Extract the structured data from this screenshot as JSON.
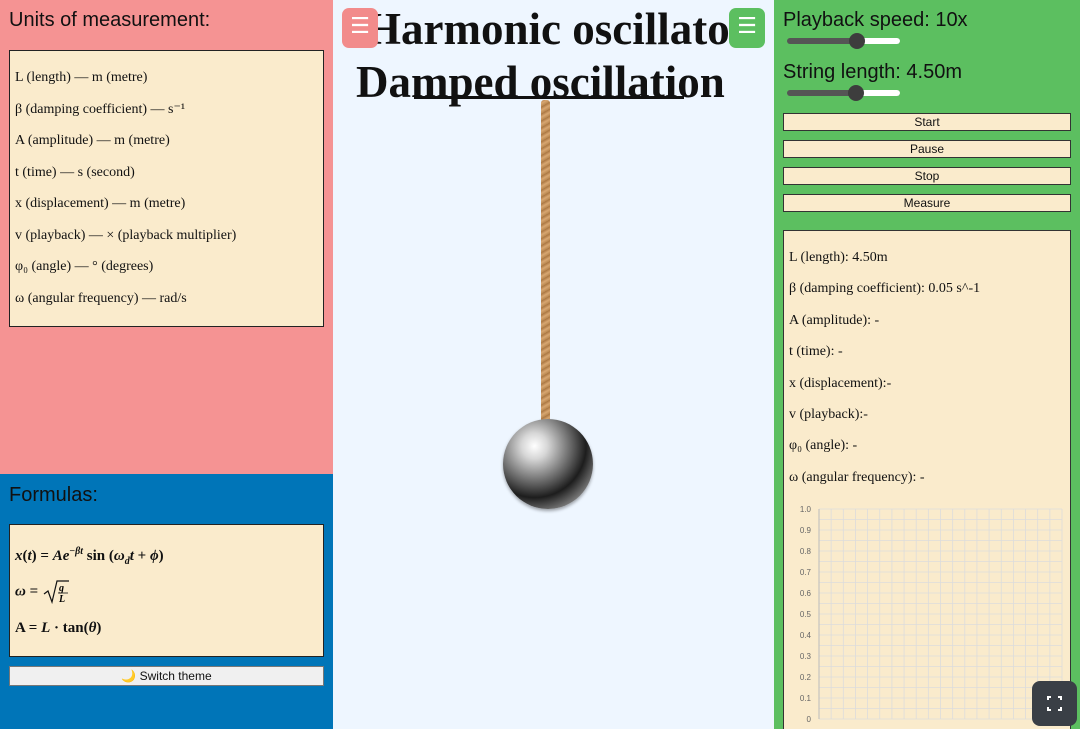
{
  "units": {
    "title": "Units of measurement:",
    "rows": [
      "L (length) — m (metre)",
      "β (damping coefficient) — s⁻¹",
      "A (amplitude) — m (metre)",
      "t (time) — s (second)",
      "x (displacement) — m (metre)",
      "v (playback) — × (playback multiplier)",
      "φ₀ (angle) — ° (degrees)",
      "ω (angular frequency) — rad/s"
    ]
  },
  "formulas": {
    "title": "Formulas:",
    "theme_button": "🌙 Switch theme"
  },
  "scene": {
    "title_line1": "Harmonic oscillator",
    "title_line2": "Damped oscillation",
    "menu_icon": "☰"
  },
  "controls": {
    "speed_label": "Playback speed: 10x",
    "speed_fraction": 0.62,
    "length_label": "String length: 4.50m",
    "length_fraction": 0.61,
    "buttons": {
      "start": "Start",
      "pause": "Pause",
      "stop": "Stop",
      "measure": "Measure"
    }
  },
  "measurements": [
    "L (length): 4.50m",
    "β (damping coefficient): 0.05 s^-1",
    "A (amplitude): -",
    "t (time): -",
    "x (displacement):-",
    "v (playback):-",
    "φ₀ (angle): -",
    "ω (angular frequency): -"
  ],
  "chart_data": {
    "type": "line",
    "title": "",
    "xlabel": "",
    "ylabel": "",
    "ylim": [
      0,
      1.0
    ],
    "y_ticks": [
      "0",
      "0.1",
      "0.2",
      "0.3",
      "0.4",
      "0.5",
      "0.6",
      "0.7",
      "0.8",
      "0.9",
      "1.0"
    ],
    "series": [],
    "grid": true
  },
  "colors": {
    "units_panel": "#f59393",
    "formulas_panel": "#0075b8",
    "controls_panel": "#5cbf60",
    "cream": "#faebcc",
    "scene_bg": "#eef6ff"
  }
}
